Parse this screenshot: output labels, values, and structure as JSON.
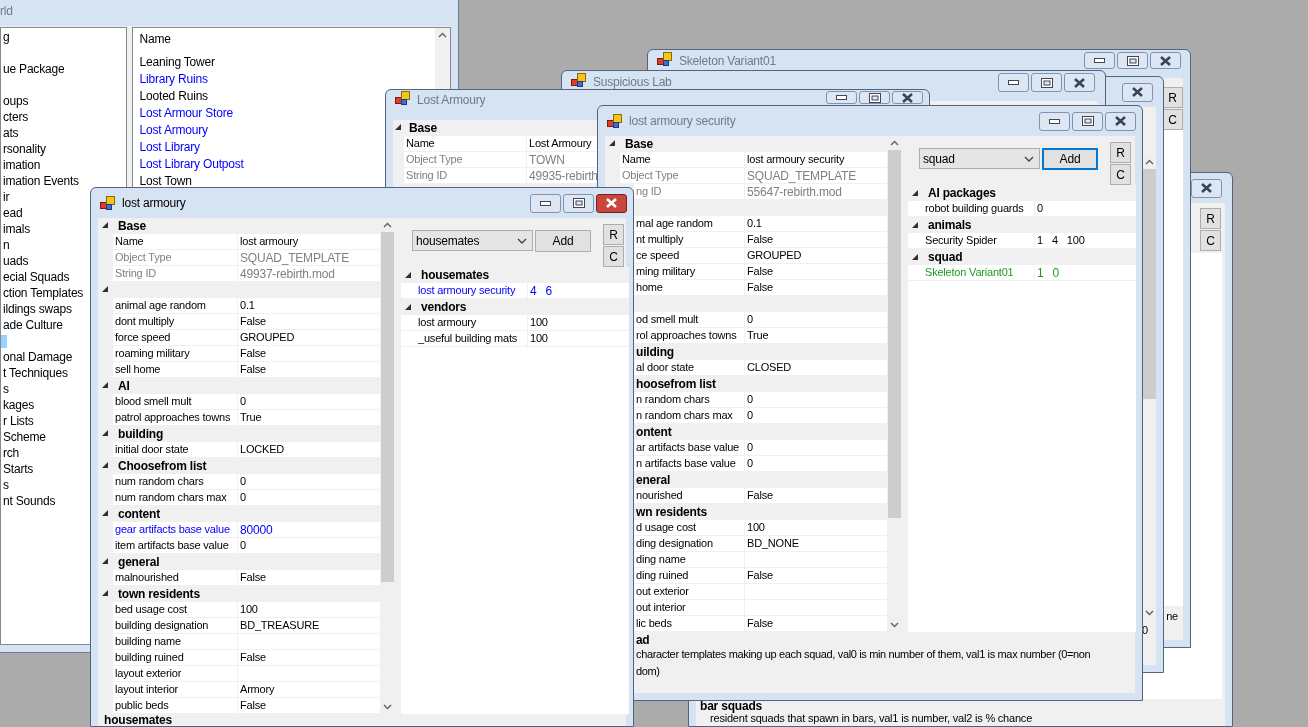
{
  "world_window": {
    "title": "rld",
    "active": false,
    "tree_items": [
      "g",
      "ue Package",
      "oups",
      "cters",
      "ats",
      "rsonality",
      "imation",
      "imation Events",
      "ir",
      "ead",
      "imals",
      "n",
      "uads",
      "ecial Squads",
      "ction Templates",
      "ildings swaps",
      "ade Culture",
      "onal Damage",
      "t Techniques",
      "s",
      "kages",
      "r Lists",
      "Scheme",
      "rch",
      "Starts",
      "s",
      "nt Sounds"
    ],
    "list": {
      "header": "Name",
      "items": [
        {
          "text": "Leaning Tower",
          "color": "#000000"
        },
        {
          "text": "Library Ruins",
          "color": "#0000ff"
        },
        {
          "text": "Looted Ruins",
          "color": "#000000"
        },
        {
          "text": "Lost Armour Store",
          "color": "#0000ff"
        },
        {
          "text": "Lost Armoury",
          "color": "#0000ff"
        },
        {
          "text": "Lost Library",
          "color": "#0000ff"
        },
        {
          "text": "Lost Library Outpost",
          "color": "#0000ff"
        },
        {
          "text": "Lost Town",
          "color": "#000000"
        }
      ]
    }
  },
  "rear_window": {
    "active": false,
    "side_buttons": [
      "R",
      "C"
    ],
    "description": {
      "title": "bar squads",
      "lines": [
        "resident squads that spawn in bars, val1 is number, val2 is % chance"
      ]
    }
  },
  "skeleton_window": {
    "title": "Skeleton Variant01",
    "active": false,
    "side_buttons": [
      "R",
      "C"
    ],
    "description": {
      "lines": [
        "ne"
      ]
    }
  },
  "middle_window": {
    "active": false,
    "description": {
      "lines": [
        "0"
      ]
    }
  },
  "suspicious_lab_window": {
    "title": "Suspicious Lab",
    "active": false
  },
  "town_window": {
    "title": "Lost Armoury",
    "active": false,
    "sections": [
      {
        "name": "Base",
        "rows": [
          {
            "label": "Name",
            "value": "Lost Armoury"
          },
          {
            "label": "Object Type",
            "value": "TOWN",
            "color": "#808080"
          },
          {
            "label": "String ID",
            "value": "49935-rebirth",
            "color": "#808080"
          }
        ]
      }
    ]
  },
  "template_windows": [
    {
      "title": "lost armoury security",
      "active": false,
      "sections": [
        {
          "name": "Base",
          "rows": [
            {
              "label": "Name",
              "value": "lost armoury security"
            },
            {
              "label": "Object Type",
              "value": "SQUAD_TEMPLATE",
              "color": "#808080"
            },
            {
              "label": "ng ID",
              "value": "55647-rebirth.mod",
              "color": "#808080"
            }
          ]
        },
        {
          "rows": [
            {
              "label": "mal age random",
              "value": "0.1"
            },
            {
              "label": "nt multiply",
              "value": "False"
            },
            {
              "label": "ce speed",
              "value": "GROUPED"
            },
            {
              "label": "ming military",
              "value": "False"
            },
            {
              "label": "home",
              "value": "False"
            }
          ]
        },
        {
          "rows": [
            {
              "label": "od smell mult",
              "value": "0"
            },
            {
              "label": "rol approaches towns",
              "value": "True"
            }
          ]
        },
        {
          "name": "uilding",
          "rows": [
            {
              "label": "al door state",
              "value": "CLOSED"
            }
          ]
        },
        {
          "name": "hoosefrom list",
          "rows": [
            {
              "label": "n random chars",
              "value": "0"
            },
            {
              "label": "n random chars max",
              "value": "0"
            }
          ]
        },
        {
          "name": "ontent",
          "rows": [
            {
              "label": "ar artifacts base value",
              "value": "0"
            },
            {
              "label": "n artifacts base value",
              "value": "0"
            }
          ]
        },
        {
          "name": "eneral",
          "rows": [
            {
              "label": "nourished",
              "value": "False"
            }
          ]
        },
        {
          "name": "wn residents",
          "rows": [
            {
              "label": "d usage cost",
              "value": "100"
            },
            {
              "label": "ding designation",
              "value": "BD_NONE"
            },
            {
              "label": "ding name"
            },
            {
              "label": "ding ruined",
              "value": "False"
            },
            {
              "label": "out exterior"
            },
            {
              "label": "out interior"
            },
            {
              "label": "lic beds",
              "value": "False"
            }
          ]
        }
      ],
      "picker": {
        "value": "squad",
        "button": "Add",
        "focused": true
      },
      "side_buttons": [
        "R",
        "C"
      ],
      "lists": [
        {
          "name": "AI packages",
          "rows": [
            {
              "label": "robot building guards",
              "values": [
                "0"
              ]
            }
          ]
        },
        {
          "name": "animals",
          "rows": [
            {
              "label": "Security Spider",
              "values": [
                "1",
                "4",
                "100"
              ]
            }
          ]
        },
        {
          "name": "squad",
          "rows": [
            {
              "label": "Skeleton Variant01",
              "values": [
                "1",
                "0"
              ],
              "color": "#1f9b1f"
            }
          ]
        }
      ],
      "description": {
        "title": "ad",
        "lines": [
          "character templates making up each squad, val0 is min number of them, val1 is max number (0=non",
          "dom)"
        ]
      }
    },
    {
      "title": "lost armoury",
      "active": true,
      "sections": [
        {
          "name": "Base",
          "rows": [
            {
              "label": "Name",
              "value": "lost armoury"
            },
            {
              "label": "Object Type",
              "value": "SQUAD_TEMPLATE",
              "color": "#808080"
            },
            {
              "label": "String ID",
              "value": "49937-rebirth.mod",
              "color": "#808080"
            }
          ]
        },
        {
          "rows": [
            {
              "label": "animal age random",
              "value": "0.1"
            },
            {
              "label": "dont multiply",
              "value": "False"
            },
            {
              "label": "force speed",
              "value": "GROUPED"
            },
            {
              "label": "roaming military",
              "value": "False"
            },
            {
              "label": "sell home",
              "value": "False"
            }
          ]
        },
        {
          "name": "AI",
          "rows": [
            {
              "label": "blood smell mult",
              "value": "0"
            },
            {
              "label": "patrol approaches towns",
              "value": "True"
            }
          ]
        },
        {
          "name": "building",
          "rows": [
            {
              "label": "initial door state",
              "value": "LOCKED"
            }
          ]
        },
        {
          "name": "Choosefrom list",
          "rows": [
            {
              "label": "num random chars",
              "value": "0"
            },
            {
              "label": "num random chars max",
              "value": "0"
            }
          ]
        },
        {
          "name": "content",
          "rows": [
            {
              "label": "gear artifacts base value",
              "value": "80000",
              "color": "#0000ff"
            },
            {
              "label": "item artifacts base value",
              "value": "0"
            }
          ]
        },
        {
          "name": "general",
          "rows": [
            {
              "label": "malnourished",
              "value": "False"
            }
          ]
        },
        {
          "name": "town residents",
          "rows": [
            {
              "label": "bed usage cost",
              "value": "100"
            },
            {
              "label": "building designation",
              "value": "BD_TREASURE"
            },
            {
              "label": "building name"
            },
            {
              "label": "building ruined",
              "value": "False"
            },
            {
              "label": "layout exterior"
            },
            {
              "label": "layout interior",
              "value": "Armory"
            },
            {
              "label": "public beds",
              "value": "False"
            }
          ]
        }
      ],
      "picker": {
        "value": "housemates",
        "button": "Add",
        "focused": false
      },
      "side_buttons": [
        "R",
        "C"
      ],
      "lists": [
        {
          "name": "housemates",
          "rows": [
            {
              "label": "lost armoury security",
              "values": [
                "4",
                "6"
              ],
              "color": "#0000ff"
            }
          ]
        },
        {
          "name": "vendors",
          "rows": [
            {
              "label": "lost armoury",
              "values": [
                "100"
              ]
            },
            {
              "label": "_useful building mats",
              "values": [
                "100"
              ]
            }
          ]
        }
      ],
      "description": {
        "title": "housemates"
      }
    }
  ]
}
